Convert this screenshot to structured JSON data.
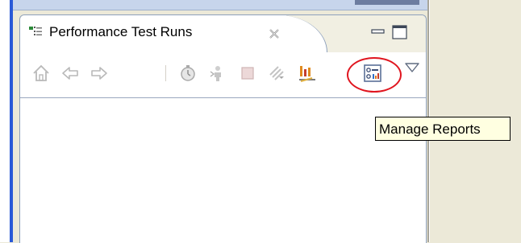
{
  "view": {
    "title": "Performance Test Runs"
  },
  "toolbar": {
    "items": [
      {
        "icon": "home-icon",
        "state": "disabled"
      },
      {
        "icon": "back-arrow-icon",
        "state": "disabled"
      },
      {
        "icon": "forward-arrow-icon",
        "state": "disabled"
      },
      {
        "icon": "timer-run-icon",
        "state": "disabled"
      },
      {
        "icon": "user-run-icon",
        "state": "disabled"
      },
      {
        "icon": "stop-icon",
        "state": "disabled"
      },
      {
        "icon": "refresh-icon",
        "state": "disabled"
      },
      {
        "icon": "reports-chart-icon",
        "state": "enabled"
      },
      {
        "icon": "manage-reports-icon",
        "state": "enabled",
        "highlighted": true
      },
      {
        "icon": "view-menu-chevron-icon",
        "state": "enabled"
      }
    ]
  },
  "tooltip": {
    "text": "Manage Reports"
  },
  "colors": {
    "highlight_ring": "#e0151f",
    "accent_blue": "#2a5ad7",
    "tooltip_bg": "#ffffe1"
  }
}
